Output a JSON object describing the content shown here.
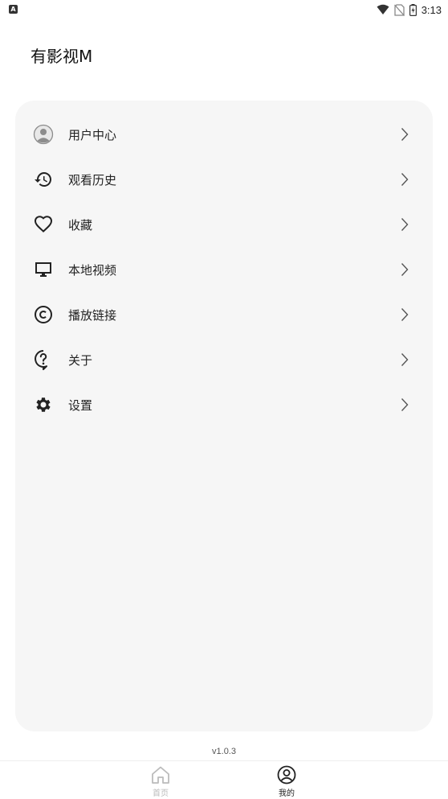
{
  "status_bar": {
    "notification_glyph": "A",
    "time": "3:13",
    "icons": [
      "wifi-icon",
      "no-sim-icon",
      "battery-charging-icon"
    ]
  },
  "app": {
    "title": "有影视M"
  },
  "menu": {
    "items": [
      {
        "label": "用户中心",
        "icon": "user-avatar-icon"
      },
      {
        "label": "观看历史",
        "icon": "history-icon"
      },
      {
        "label": "收藏",
        "icon": "heart-icon"
      },
      {
        "label": "本地视频",
        "icon": "monitor-icon"
      },
      {
        "label": "播放链接",
        "icon": "copyright-icon"
      },
      {
        "label": "关于",
        "icon": "help-icon"
      },
      {
        "label": "设置",
        "icon": "gear-icon"
      }
    ]
  },
  "footer": {
    "version": "v1.0.3"
  },
  "bottom_nav": {
    "tabs": [
      {
        "label": "首页",
        "icon": "home-icon",
        "active": false
      },
      {
        "label": "我的",
        "icon": "profile-icon",
        "active": true
      }
    ]
  },
  "colors": {
    "card_bg": "#f6f6f6",
    "text": "#222222",
    "inactive_tab": "#bbbbbb",
    "active_tab": "#222222"
  }
}
